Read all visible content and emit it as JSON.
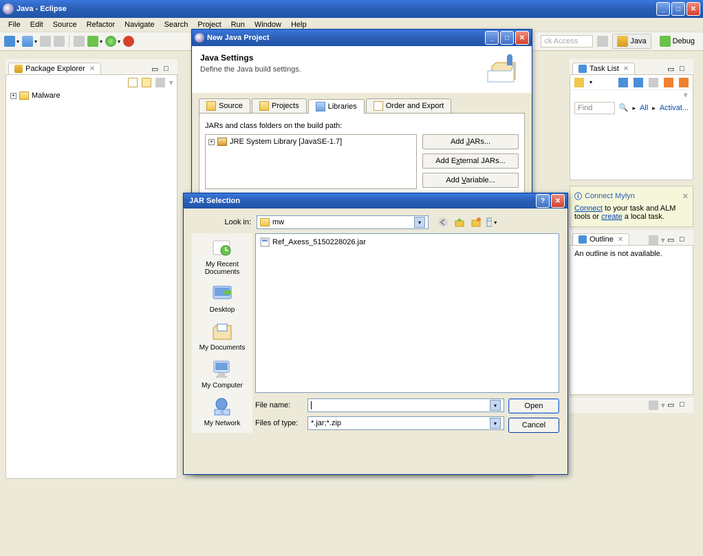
{
  "eclipse": {
    "title": "Java - Eclipse",
    "menus": [
      "File",
      "Edit",
      "Source",
      "Refactor",
      "Navigate",
      "Search",
      "Project",
      "Run",
      "Window",
      "Help"
    ],
    "quick_access_placeholder": "ck Access",
    "perspectives": {
      "java": "Java",
      "debug": "Debug"
    }
  },
  "package_explorer": {
    "tab": "Package Explorer",
    "items": [
      {
        "label": "Malware"
      }
    ]
  },
  "tasklist": {
    "tab": "Task List",
    "find": "Find",
    "all": "All",
    "activate": "Activat..."
  },
  "mylyn": {
    "title": "Connect Mylyn",
    "text_pre": "Connect",
    "text_mid": " to your task and ALM tools or ",
    "text_create": "create",
    "text_post": " a local task."
  },
  "outline": {
    "tab": "Outline",
    "empty": "An outline is not available."
  },
  "wizard": {
    "window_title": "New Java Project",
    "heading": "Java Settings",
    "desc": "Define the Java build settings.",
    "tabs": {
      "source": "Source",
      "projects": "Projects",
      "libraries": "Libraries",
      "order": "Order and Export"
    },
    "jar_label": "JARs and class folders on the build path:",
    "jre_entry": "JRE System Library [JavaSE-1.7]",
    "buttons": {
      "add_jars": "Add JARs...",
      "add_ext_jars": "Add External JARs...",
      "add_variable": "Add Variable..."
    }
  },
  "file_dialog": {
    "title": "JAR Selection",
    "look_in_label": "Look in:",
    "look_in_value": "mw",
    "files": [
      "Ref_Axess_5150228026.jar"
    ],
    "places": {
      "recent": "My Recent Documents",
      "desktop": "Desktop",
      "documents": "My Documents",
      "computer": "My Computer",
      "network": "My Network"
    },
    "file_name_label": "File name:",
    "file_name_value": "",
    "file_type_label": "Files of type:",
    "file_type_value": "*.jar;*.zip",
    "open": "Open",
    "cancel": "Cancel"
  }
}
